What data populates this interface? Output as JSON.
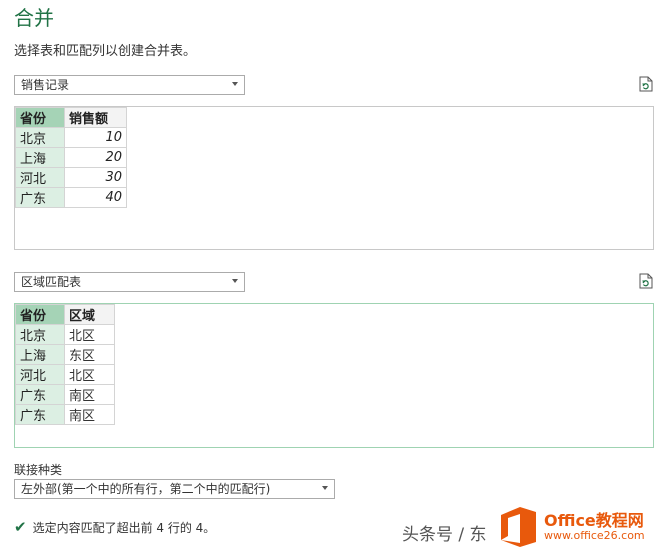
{
  "dialog": {
    "title": "合并",
    "description": "选择表和匹配列以创建合并表。"
  },
  "table1": {
    "selected": "销售记录",
    "headers": [
      "省份",
      "销售额"
    ],
    "rows": [
      [
        "北京",
        "10"
      ],
      [
        "上海",
        "20"
      ],
      [
        "河北",
        "30"
      ],
      [
        "广东",
        "40"
      ]
    ]
  },
  "table2": {
    "selected": "区域匹配表",
    "headers": [
      "省份",
      "区域"
    ],
    "rows": [
      [
        "北京",
        "北区"
      ],
      [
        "上海",
        "东区"
      ],
      [
        "河北",
        "北区"
      ],
      [
        "广东",
        "南区"
      ],
      [
        "广东",
        "南区"
      ]
    ]
  },
  "join": {
    "label": "联接种类",
    "selected": "左外部(第一个中的所有行，第二个中的匹配行)"
  },
  "status": {
    "text": "选定内容匹配了超出前 4 行的 4。"
  },
  "watermark": {
    "author": "头条号 / 东",
    "brand": "Office教程网",
    "site": "www.office26.com"
  },
  "colors": {
    "accent": "#217346",
    "key_header": "#a5d3b6",
    "key_cell": "#dcefe3",
    "watermark": "#e8590c"
  }
}
